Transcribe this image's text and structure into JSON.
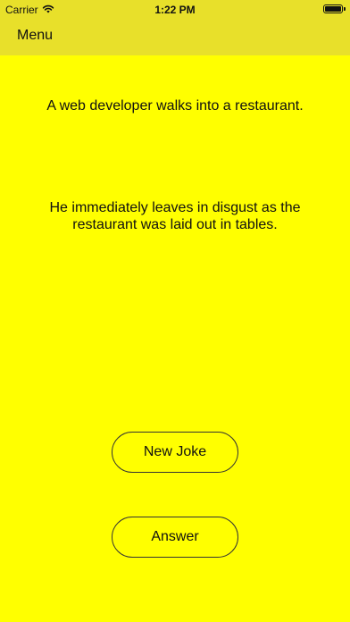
{
  "status_bar": {
    "carrier": "Carrier",
    "time": "1:22 PM",
    "wifi_icon": "wifi-icon",
    "battery_icon": "battery-icon",
    "battery_level": 1.0
  },
  "nav": {
    "menu_label": "Menu"
  },
  "joke": {
    "setup": "A web developer walks into a restaurant.",
    "punchline": "He immediately leaves in disgust as the restaurant was laid out in tables."
  },
  "buttons": {
    "new_joke_label": "New Joke",
    "answer_label": "Answer"
  },
  "colors": {
    "background": "#ffff00",
    "bar": "#e8e02a"
  }
}
